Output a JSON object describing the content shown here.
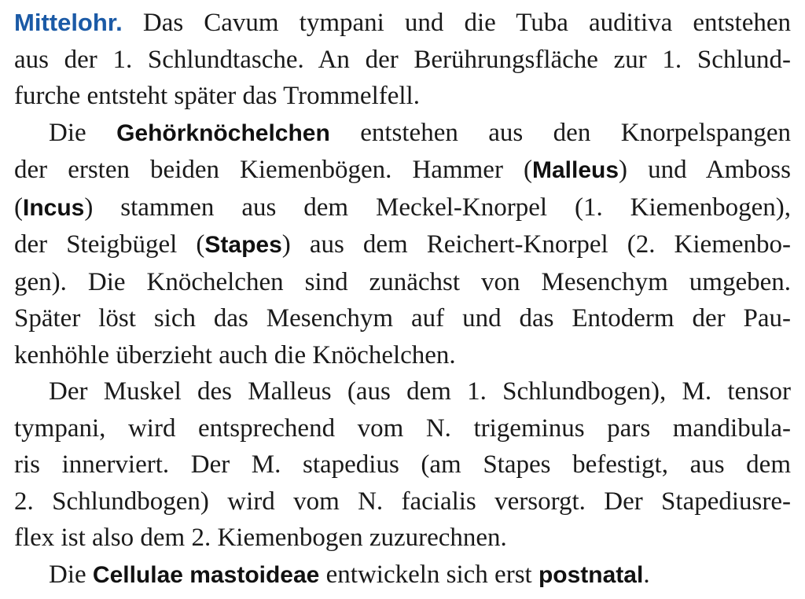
{
  "section": {
    "heading": "Mittelohr.",
    "p1": {
      "l1_rest": "Das Cavum tympani und die Tuba auditiva entstehen",
      "l2": "aus der 1. Schlundtasche. An der Berührungsfläche zur 1. Schlund-",
      "l3": "furche entsteht später das Trommelfell."
    },
    "p2": {
      "l1_a": "Die ",
      "l1_b": "Gehörknöchelchen",
      "l1_c": " entstehen aus den Knorpelspangen",
      "l2_a": "der ersten beiden Kiemenbögen. Hammer (",
      "l2_b": "Malleus",
      "l2_c": ") und Amboss",
      "l3_a": "(",
      "l3_b": "Incus",
      "l3_c": ") stammen aus dem Meckel-Knorpel (1. Kiemenbogen),",
      "l4_a": "der Steigbügel (",
      "l4_b": "Stapes",
      "l4_c": ") aus dem Reichert-Knorpel (2. Kiemenbo-",
      "l5": "gen). Die Knöchelchen sind zunächst von Mesenchym umgeben.",
      "l6": "Später löst sich das Mesenchym auf und das Entoderm der Pau-",
      "l7": "kenhöhle überzieht auch die Knöchelchen."
    },
    "p3": {
      "l1": "Der Muskel des Malleus (aus dem 1. Schlundbogen), M. tensor",
      "l2": "tympani, wird entsprechend vom N. trigeminus pars mandibula-",
      "l3": "ris innerviert. Der M. stapedius (am Stapes befestigt, aus dem",
      "l4": "2. Schlundbogen) wird vom N. facialis versorgt. Der Stapediusre-",
      "l5": "flex ist also dem 2. Kiemenbogen zuzurechnen."
    },
    "p4": {
      "l1_a": "Die ",
      "l1_b": "Cellulae mastoideae",
      "l1_c": " entwickeln sich erst ",
      "l1_d": "postnatal",
      "l1_e": "."
    }
  }
}
